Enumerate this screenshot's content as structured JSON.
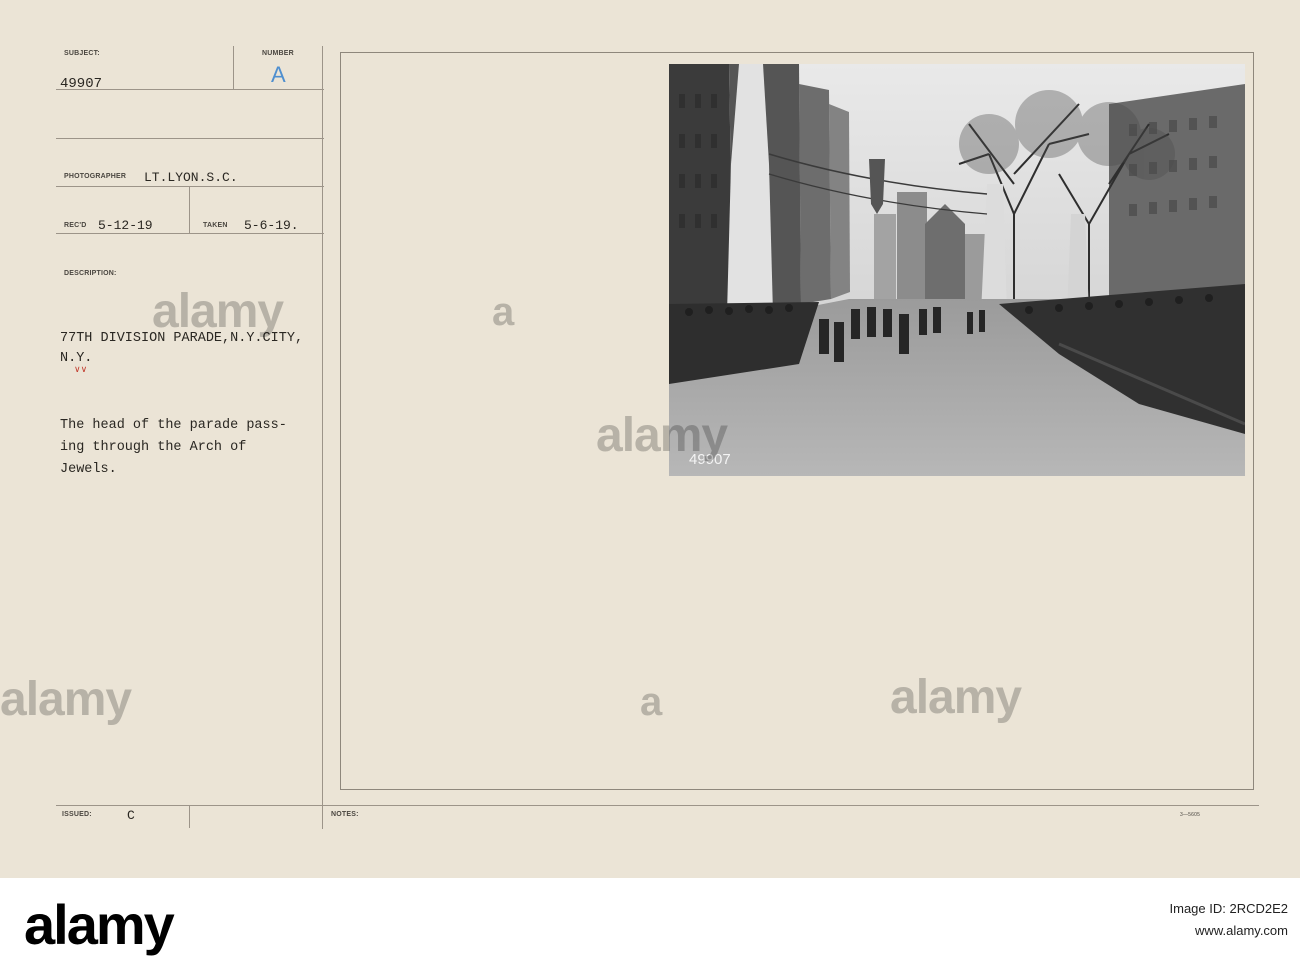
{
  "form": {
    "subject_label": "SUBJECT:",
    "subject_value": "49907",
    "number_label": "NUMBER",
    "number_value": "A",
    "photographer_label": "PHOTOGRAPHER",
    "photographer_value": "LT.LYON.S.C.",
    "recd_label": "REC'D",
    "recd_value": "5-12-19",
    "taken_label": "TAKEN",
    "taken_value": "5-6-19.",
    "description_label": "DESCRIPTION:",
    "title_line1": "77TH DIVISION PARADE,N.Y.CITY,",
    "title_line2": "N.Y.",
    "body_line1": "The head of the parade pass-",
    "body_line2": "ing through the Arch of",
    "body_line3": "Jewels.",
    "issued_label": "ISSUED:",
    "issued_value": "C",
    "notes_label": "NOTES:",
    "form_code": "3—5605"
  },
  "photo": {
    "negative_number": "49907",
    "subject_icon": "parade-street-photo"
  },
  "watermark": {
    "text": "alamy",
    "marks": [
      "a",
      "a"
    ]
  },
  "footer": {
    "logo": "alamy",
    "image_id_line": "Image ID: 2RCD2E2",
    "url_line": "www.alamy.com"
  },
  "colors": {
    "card": "#ebe4d6",
    "number_blue": "#4f8fcf",
    "stamp_red": "#c0392b"
  }
}
